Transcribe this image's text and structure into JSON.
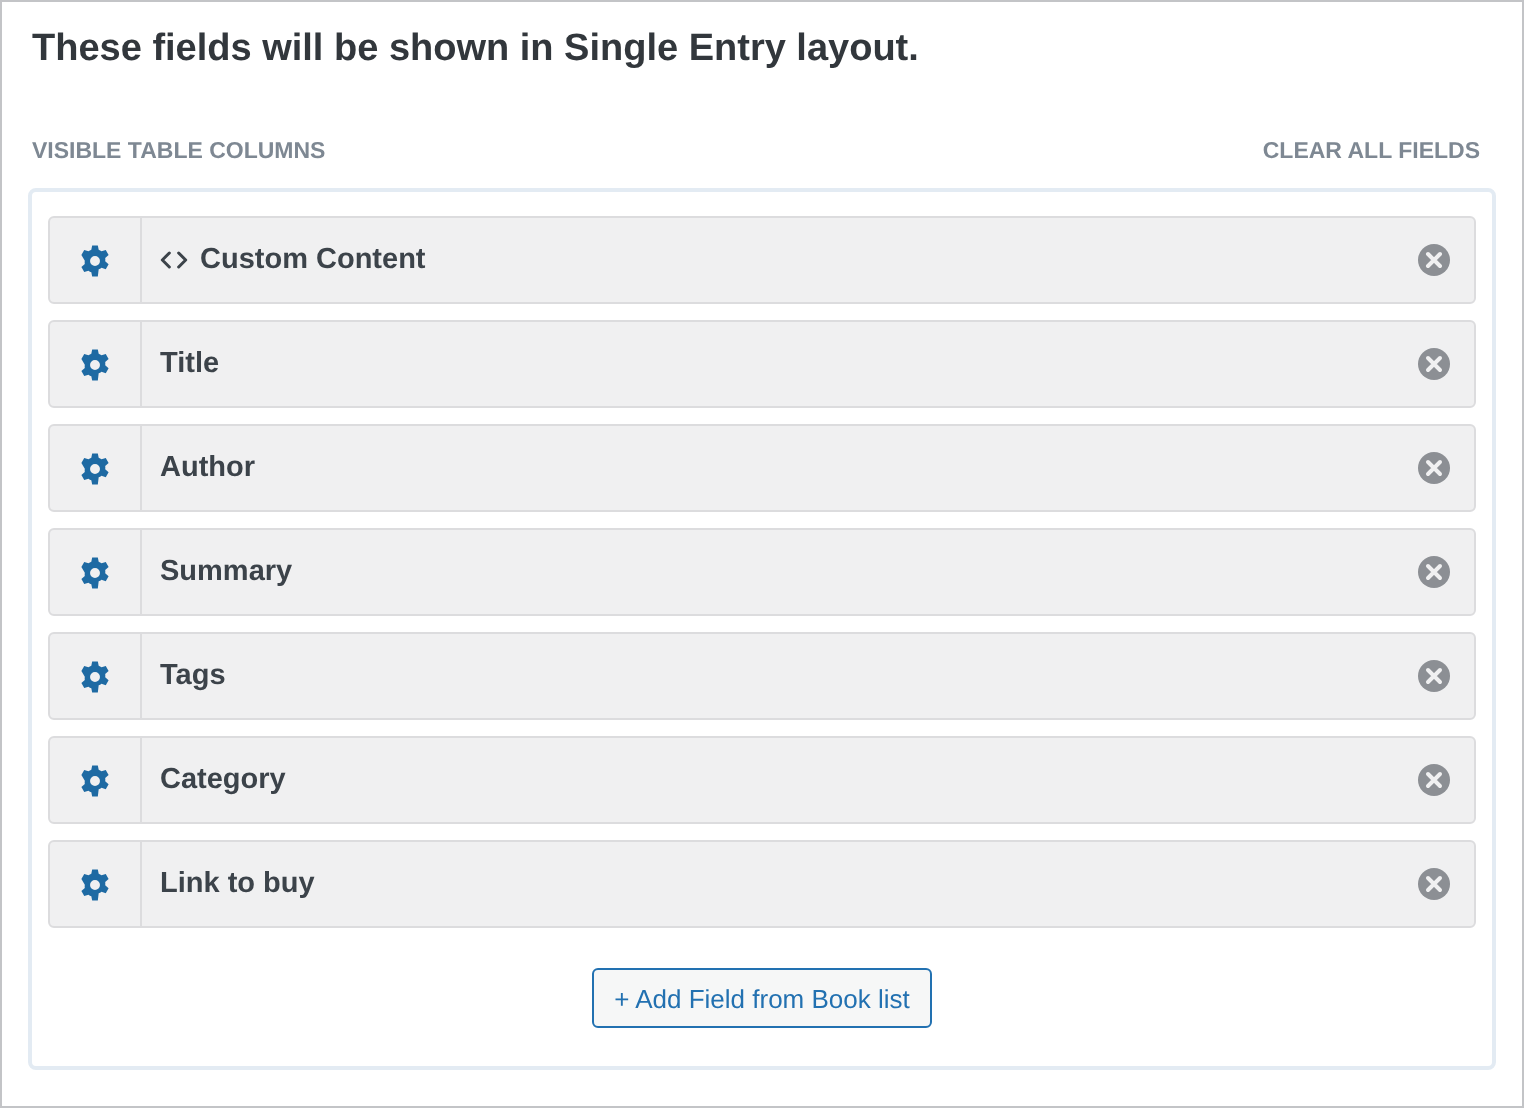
{
  "heading": "These fields will be shown in Single Entry layout.",
  "section_label": "VISIBLE TABLE COLUMNS",
  "clear_link": "CLEAR ALL FIELDS",
  "fields": [
    {
      "label": "Custom Content",
      "kind": "code"
    },
    {
      "label": "Title",
      "kind": "field"
    },
    {
      "label": "Author",
      "kind": "field"
    },
    {
      "label": "Summary",
      "kind": "field"
    },
    {
      "label": "Tags",
      "kind": "field"
    },
    {
      "label": "Category",
      "kind": "field"
    },
    {
      "label": "Link to buy",
      "kind": "field"
    }
  ],
  "add_button": "+ Add Field from Book list"
}
